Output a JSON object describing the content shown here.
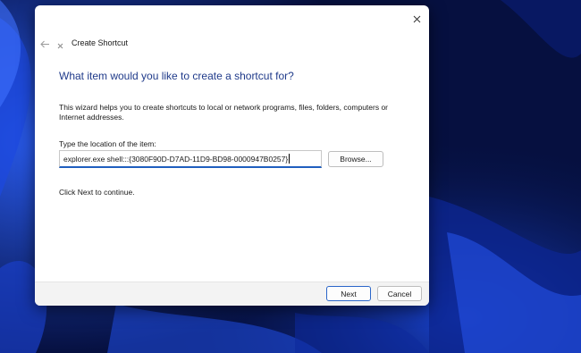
{
  "desktop": {
    "wallpaper_colors": [
      "#051040",
      "#1233b8",
      "#2a5cf0",
      "#0a1a6a"
    ]
  },
  "dialog": {
    "title": "Create Shortcut",
    "heading": "What item would you like to create a shortcut for?",
    "description": "This wizard helps you to create shortcuts to local or network programs, files, folders, computers or Internet addresses.",
    "location_label": "Type the location of the item:",
    "location_value": "explorer.exe shell:::{3080F90D-D7AD-11D9-BD98-0000947B0257}",
    "browse_label": "Browse...",
    "continue_note": "Click Next to continue.",
    "next_label": "Next",
    "cancel_label": "Cancel",
    "accent_color": "#1f5fbf",
    "heading_color": "#1f3a8a"
  }
}
